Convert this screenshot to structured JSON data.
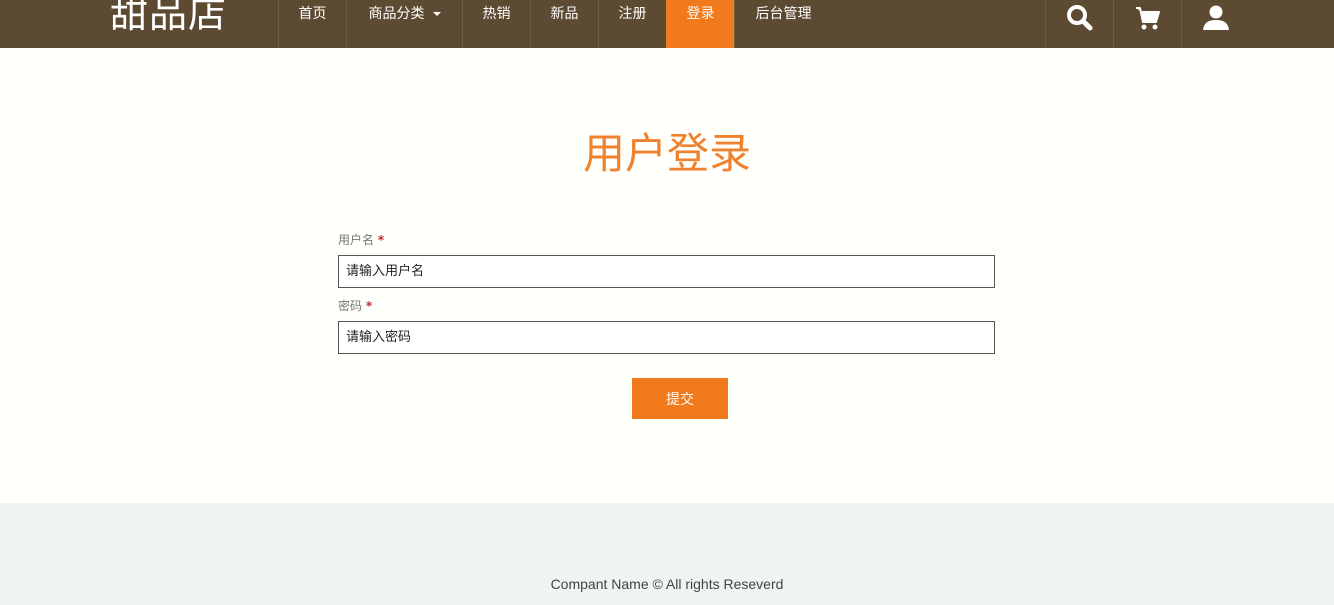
{
  "header": {
    "logo": "甜品店",
    "nav": [
      {
        "label": "首页",
        "active": false
      },
      {
        "label": "商品分类",
        "active": false,
        "dropdown": true
      },
      {
        "label": "热销",
        "active": false
      },
      {
        "label": "新品",
        "active": false
      },
      {
        "label": "注册",
        "active": false
      },
      {
        "label": "登录",
        "active": true
      },
      {
        "label": "后台管理",
        "active": false
      }
    ],
    "icons": [
      "search-icon",
      "cart-icon",
      "user-icon"
    ]
  },
  "login": {
    "title": "用户登录",
    "username_label": "用户名",
    "username_placeholder": "请输入用户名",
    "password_label": "密码",
    "password_placeholder": "请输入密码",
    "required_mark": "*",
    "submit_label": "提交"
  },
  "footer": {
    "text": "Compant Name © All rights Reseverd"
  },
  "colors": {
    "header_bg": "#5d4a32",
    "accent": "#f07a1c",
    "title": "#f0812d",
    "footer_bg": "#eff4f3"
  }
}
